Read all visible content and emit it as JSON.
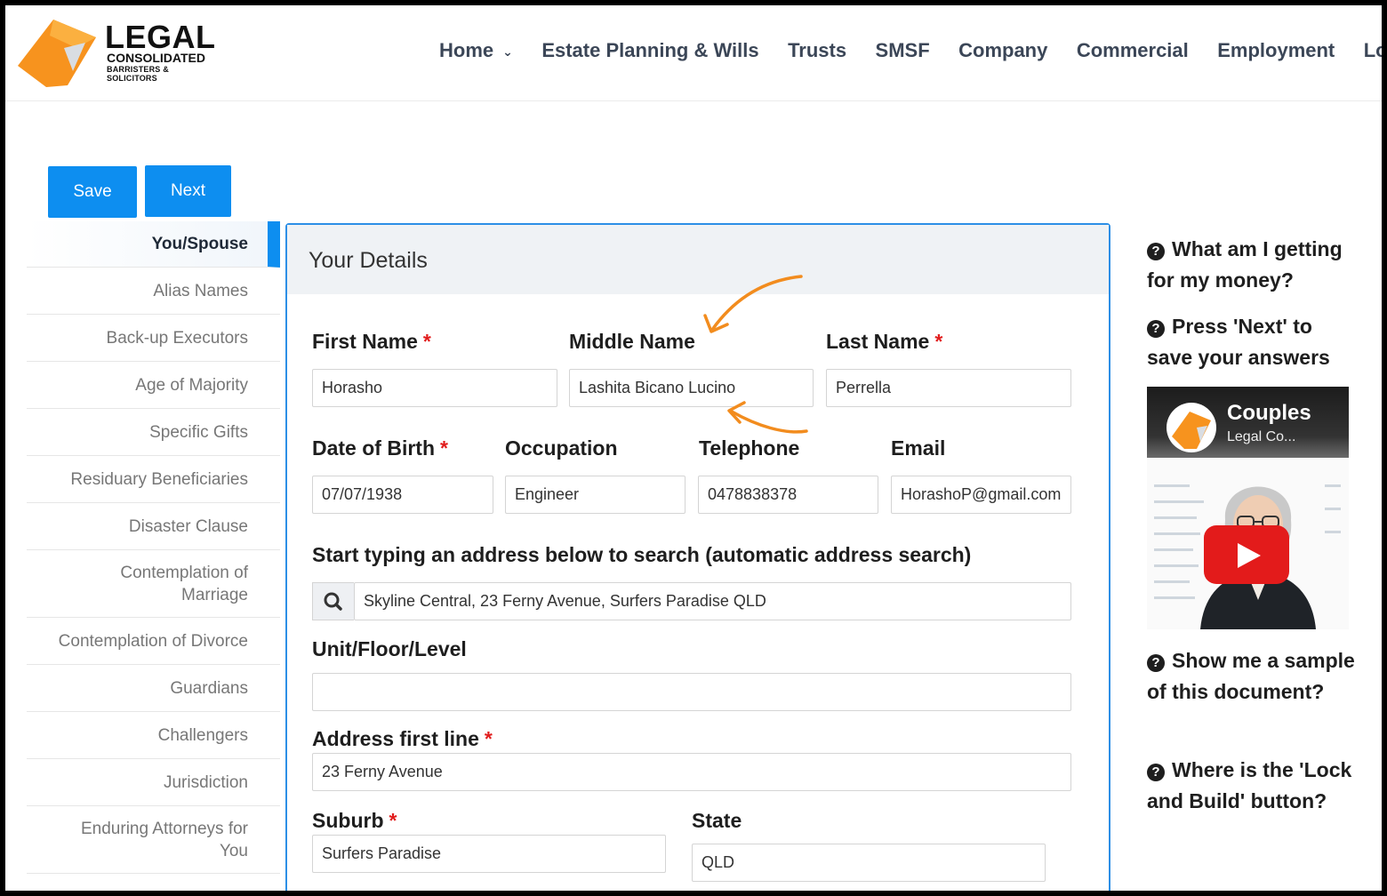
{
  "brand": {
    "name": "LEGAL",
    "subtitle": "CONSOLIDATED",
    "tagline": "BARRISTERS & SOLICITORS",
    "accent": "#f7931e"
  },
  "nav": {
    "items": [
      "Home",
      "Estate Planning & Wills",
      "Trusts",
      "SMSF",
      "Company",
      "Commercial",
      "Employment",
      "Log"
    ]
  },
  "toolbar": {
    "save_label": "Save",
    "next_label": "Next"
  },
  "sidebar": {
    "items": [
      "You/Spouse",
      "Alias Names",
      "Back-up Executors",
      "Age of Majority",
      "Specific Gifts",
      "Residuary Beneficiaries",
      "Disaster Clause",
      "Contemplation of Marriage",
      "Contemplation of Divorce",
      "Guardians",
      "Challengers",
      "Jurisdiction",
      "Enduring Attorneys for You"
    ],
    "active": "You/Spouse"
  },
  "form": {
    "title": "Your Details",
    "first_name": {
      "label": "First Name",
      "value": "Horasho"
    },
    "middle_name": {
      "label": "Middle Name",
      "value": "Lashita Bicano Lucino"
    },
    "last_name": {
      "label": "Last Name",
      "value": "Perrella"
    },
    "dob": {
      "label": "Date of Birth",
      "value": "07/07/1938"
    },
    "occupation": {
      "label": "Occupation",
      "value": "Engineer"
    },
    "telephone": {
      "label": "Telephone",
      "value": "0478838378"
    },
    "email": {
      "label": "Email",
      "value": "HorashoP@gmail.com"
    },
    "address_search": {
      "label": "Start typing an address below to search (automatic address search)",
      "value": "Skyline Central, 23 Ferny Avenue, Surfers Paradise QLD"
    },
    "unit": {
      "label": "Unit/Floor/Level",
      "value": ""
    },
    "address_line1": {
      "label": "Address first line",
      "value": "23 Ferny Avenue"
    },
    "suburb": {
      "label": "Suburb",
      "value": "Surfers Paradise"
    },
    "state": {
      "label": "State",
      "value": "QLD"
    },
    "required_mark": "*"
  },
  "help": {
    "items": [
      "What am I getting for my money?",
      "Press 'Next' to save your answers",
      "Show me a sample of this document?",
      "Where is the 'Lock and Build' button?"
    ],
    "icon": "question-circle-icon"
  },
  "video": {
    "title": "Couples",
    "subtitle": "Legal Co...",
    "icon": "play-icon",
    "play_color": "#e31b1b"
  },
  "colors": {
    "primary": "#0d8ef0",
    "panel_border": "#2d8fe6",
    "required": "#e11d1d",
    "annotation": "#f28c1e"
  }
}
